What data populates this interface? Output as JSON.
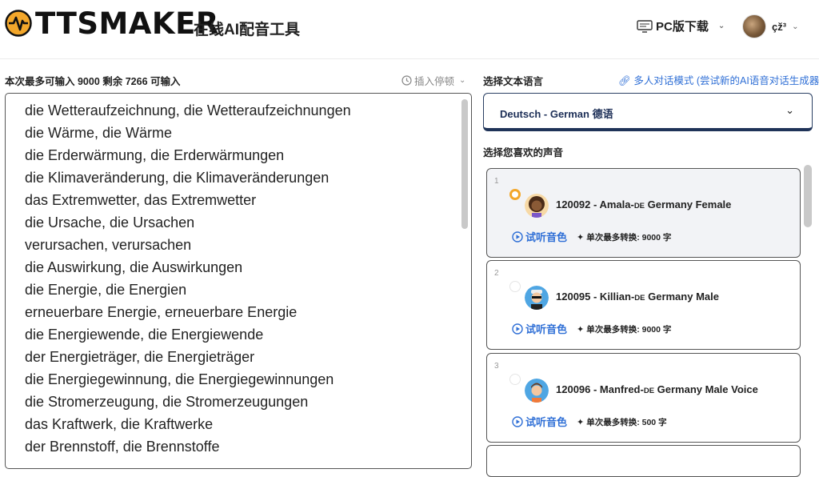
{
  "header": {
    "logo_text": "TTSMAKER",
    "tagline": "在线AI配音工具",
    "pc_download": "PC版下载",
    "username": "çž³"
  },
  "editor": {
    "limit_text": "本次最多可输入 9000 剩余 7266 可输入",
    "insert_pause": "插入停顿",
    "lines": [
      "die Wetteraufzeichnung, die Wetteraufzeichnungen",
      "die Wärme, die Wärme",
      "die Erderwärmung, die Erderwärmungen",
      "die Klimaveränderung, die Klimaveränderungen",
      "das Extremwetter, das Extremwetter",
      "die Ursache, die Ursachen",
      "verursachen, verursachen",
      "die Auswirkung, die Auswirkungen",
      "die Energie, die Energien",
      "erneuerbare Energie, erneuerbare Energie",
      "die Energiewende, die Energiewende",
      "der Energieträger, die Energieträger",
      "die Energiegewinnung, die Energiegewinnungen",
      "die Stromerzeugung, die Stromerzeugungen",
      "das Kraftwerk, die Kraftwerke",
      "der Brennstoff, die Brennstoffe"
    ]
  },
  "language": {
    "label": "选择文本语言",
    "multi_link": "多人对话模式 (尝试新的AI语音对话生成器)",
    "selected": "Deutsch - German 德语"
  },
  "voices": {
    "label": "选择您喜欢的声音",
    "listen_label": "试听音色",
    "items": [
      {
        "num": "1",
        "id_name": "120092 - Amala-",
        "de": "DE",
        "desc": " Germany Female",
        "limit": "单次最多转换: 9000 字",
        "selected": true
      },
      {
        "num": "2",
        "id_name": "120095 - Killian-",
        "de": "DE",
        "desc": " Germany Male",
        "limit": "单次最多转换: 9000 字",
        "selected": false
      },
      {
        "num": "3",
        "id_name": "120096 - Manfred-",
        "de": "DE",
        "desc": " Germany Male Voice",
        "limit": "单次最多转换: 500 字",
        "selected": false
      }
    ]
  },
  "colors": {
    "accent_blue": "#2f6fd6",
    "select_navy": "#1d2f57",
    "radio_orange": "#f3a72b"
  }
}
